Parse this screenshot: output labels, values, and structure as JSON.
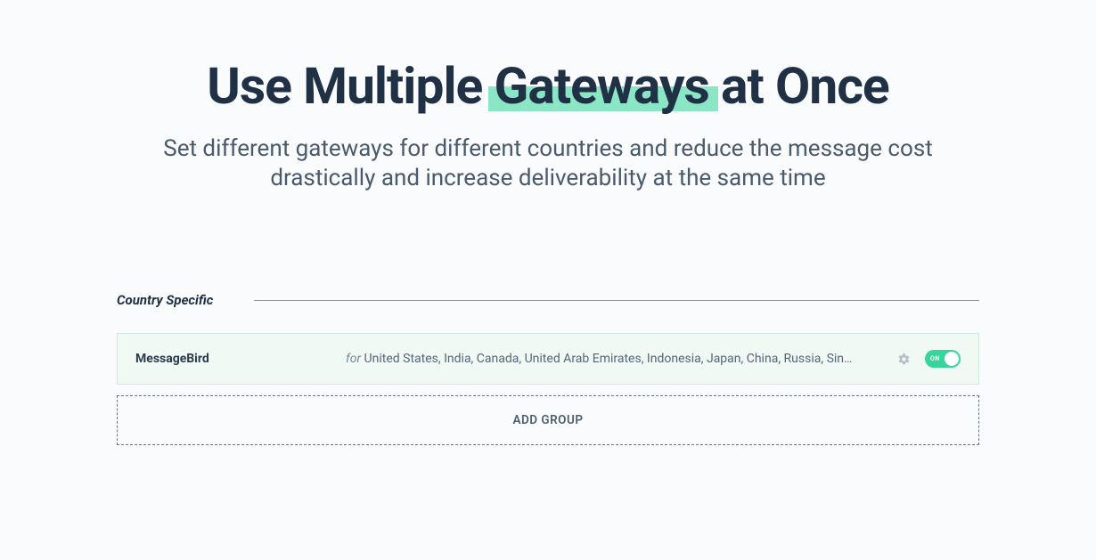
{
  "heading": {
    "pre": "Use Multiple ",
    "highlight": "Gateways",
    "post": " at Once"
  },
  "subheading": "Set different gateways for different countries and reduce the message cost drastically and increase deliverability at the same time",
  "section": {
    "title": "Country Specific"
  },
  "gateway": {
    "name": "MessageBird",
    "for_label": "for",
    "countries": " United States, India, Canada, United Arab Emirates, Indonesia, Japan, China, Russia, Sin..."
  },
  "toggle": {
    "state_label": "ON"
  },
  "actions": {
    "add_group": "ADD GROUP"
  }
}
